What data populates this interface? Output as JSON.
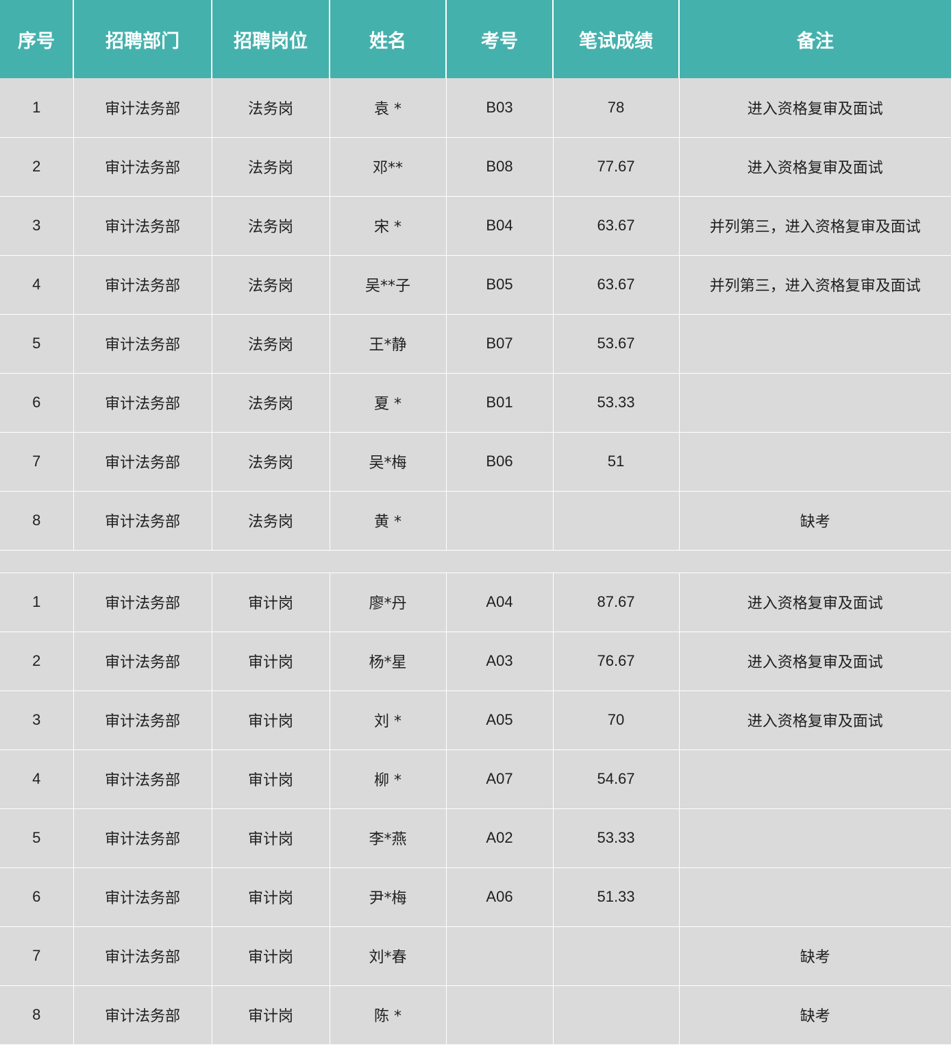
{
  "headers": [
    "序号",
    "招聘部门",
    "招聘岗位",
    "姓名",
    "考号",
    "笔试成绩",
    "备注"
  ],
  "group_legal": [
    {
      "no": "1",
      "dept": "审计法务部",
      "post": "法务岗",
      "name": "袁 *",
      "exam_no": "B03",
      "score": "78",
      "remark": "进入资格复审及面试"
    },
    {
      "no": "2",
      "dept": "审计法务部",
      "post": "法务岗",
      "name": "邓**",
      "exam_no": "B08",
      "score": "77.67",
      "remark": "进入资格复审及面试"
    },
    {
      "no": "3",
      "dept": "审计法务部",
      "post": "法务岗",
      "name": "宋 *",
      "exam_no": "B04",
      "score": "63.67",
      "remark": "并列第三，进入资格复审及面试"
    },
    {
      "no": "4",
      "dept": "审计法务部",
      "post": "法务岗",
      "name": "吴**子",
      "exam_no": "B05",
      "score": "63.67",
      "remark": "并列第三，进入资格复审及面试"
    },
    {
      "no": "5",
      "dept": "审计法务部",
      "post": "法务岗",
      "name": "王*静",
      "exam_no": "B07",
      "score": "53.67",
      "remark": ""
    },
    {
      "no": "6",
      "dept": "审计法务部",
      "post": "法务岗",
      "name": "夏 *",
      "exam_no": "B01",
      "score": "53.33",
      "remark": ""
    },
    {
      "no": "7",
      "dept": "审计法务部",
      "post": "法务岗",
      "name": "吴*梅",
      "exam_no": "B06",
      "score": "51",
      "remark": ""
    },
    {
      "no": "8",
      "dept": "审计法务部",
      "post": "法务岗",
      "name": "黄 *",
      "exam_no": "",
      "score": "",
      "remark": "缺考"
    }
  ],
  "group_audit": [
    {
      "no": "1",
      "dept": "审计法务部",
      "post": "审计岗",
      "name": "廖*丹",
      "exam_no": "A04",
      "score": "87.67",
      "remark": "进入资格复审及面试"
    },
    {
      "no": "2",
      "dept": "审计法务部",
      "post": "审计岗",
      "name": "杨*星",
      "exam_no": "A03",
      "score": "76.67",
      "remark": "进入资格复审及面试"
    },
    {
      "no": "3",
      "dept": "审计法务部",
      "post": "审计岗",
      "name": "刘 *",
      "exam_no": "A05",
      "score": "70",
      "remark": "进入资格复审及面试"
    },
    {
      "no": "4",
      "dept": "审计法务部",
      "post": "审计岗",
      "name": "柳 *",
      "exam_no": "A07",
      "score": "54.67",
      "remark": ""
    },
    {
      "no": "5",
      "dept": "审计法务部",
      "post": "审计岗",
      "name": "李*燕",
      "exam_no": "A02",
      "score": "53.33",
      "remark": ""
    },
    {
      "no": "6",
      "dept": "审计法务部",
      "post": "审计岗",
      "name": "尹*梅",
      "exam_no": "A06",
      "score": "51.33",
      "remark": ""
    },
    {
      "no": "7",
      "dept": "审计法务部",
      "post": "审计岗",
      "name": "刘*春",
      "exam_no": "",
      "score": "",
      "remark": "缺考"
    },
    {
      "no": "8",
      "dept": "审计法务部",
      "post": "审计岗",
      "name": "陈 *",
      "exam_no": "",
      "score": "",
      "remark": "缺考"
    }
  ],
  "colors": {
    "header_bg": "#45b1ad",
    "header_text": "#ffffff",
    "cell_bg": "#dadada",
    "cell_text": "#1f1f1f"
  }
}
